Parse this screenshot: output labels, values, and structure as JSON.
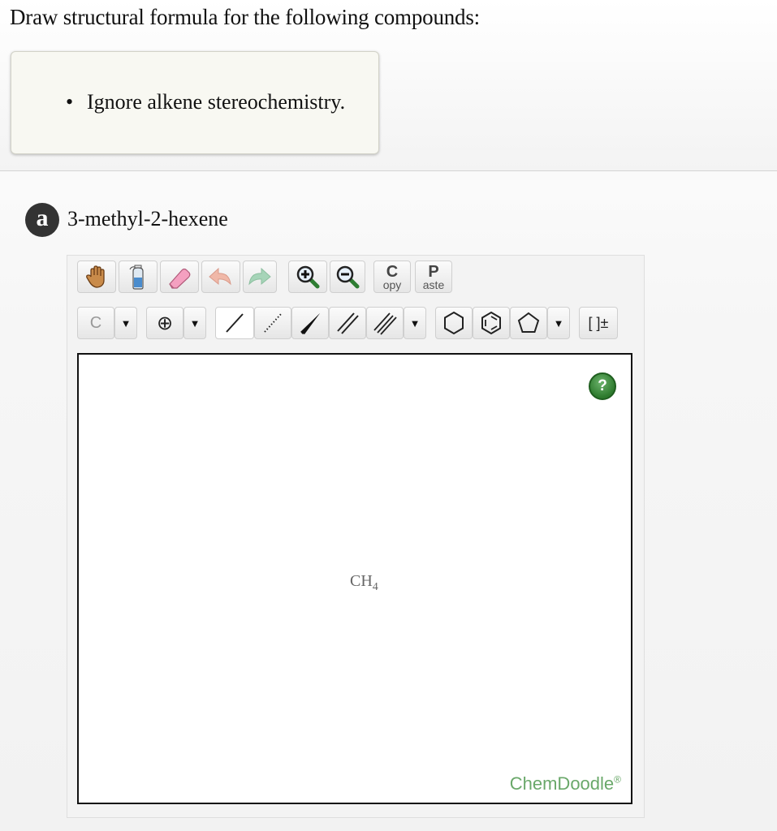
{
  "prompt": "Draw structural formula for the following compounds:",
  "notes": [
    "Ignore alkene stereochemistry."
  ],
  "part": {
    "badge": "a",
    "title": "3-methyl-2-hexene"
  },
  "toolbar": {
    "copy_big": "C",
    "copy_small": "opy",
    "paste_big": "P",
    "paste_small": "aste",
    "element_label": "C",
    "charge_label": "⊕",
    "bracket_label": "[ ]±",
    "caret": "▼"
  },
  "canvas": {
    "molecule_main": "CH",
    "molecule_sub": "4",
    "help_label": "?",
    "brand": "ChemDoodle",
    "brand_mark": "®"
  }
}
